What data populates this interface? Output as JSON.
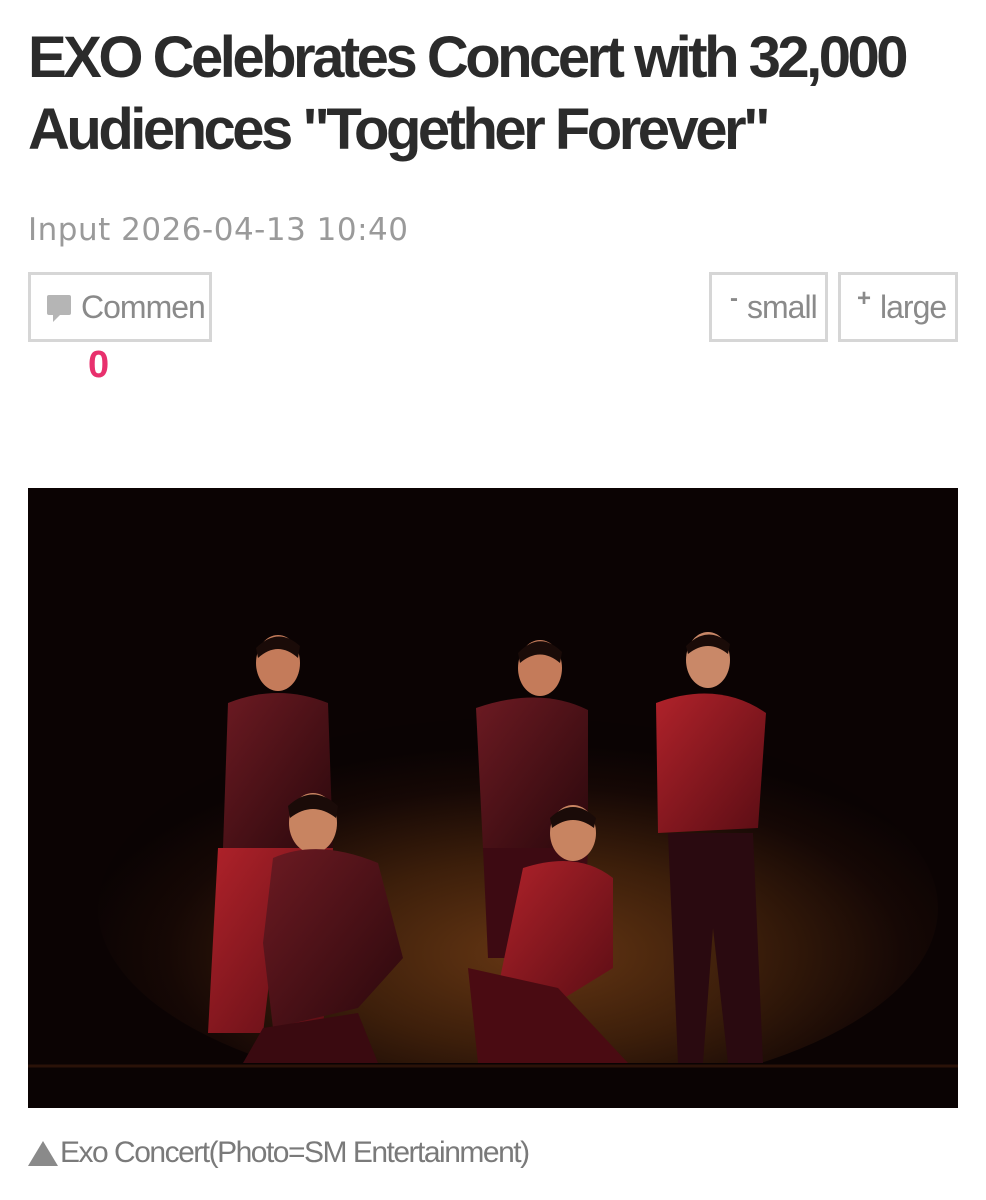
{
  "article": {
    "title": "EXO Celebrates Concert with 32,000 Audiences \"Together Forever\"",
    "input_label": "Input",
    "input_datetime": "2026-04-13 10:40"
  },
  "toolbar": {
    "comment_label": "Commen",
    "comment_count": "0",
    "small_symbol": "-",
    "small_label": "small",
    "large_symbol": "+",
    "large_label": "large"
  },
  "photo": {
    "caption": "Exo Concert(Photo=SM Entertainment)",
    "alt": "Exo Concert"
  },
  "icons": {
    "comment": "speech-bubble-icon",
    "caption_marker": "triangle-up-icon"
  },
  "colors": {
    "title": "#2b2b2b",
    "meta": "#9a9a9a",
    "comment_count": "#e8306d",
    "border": "#d6d6d6"
  }
}
